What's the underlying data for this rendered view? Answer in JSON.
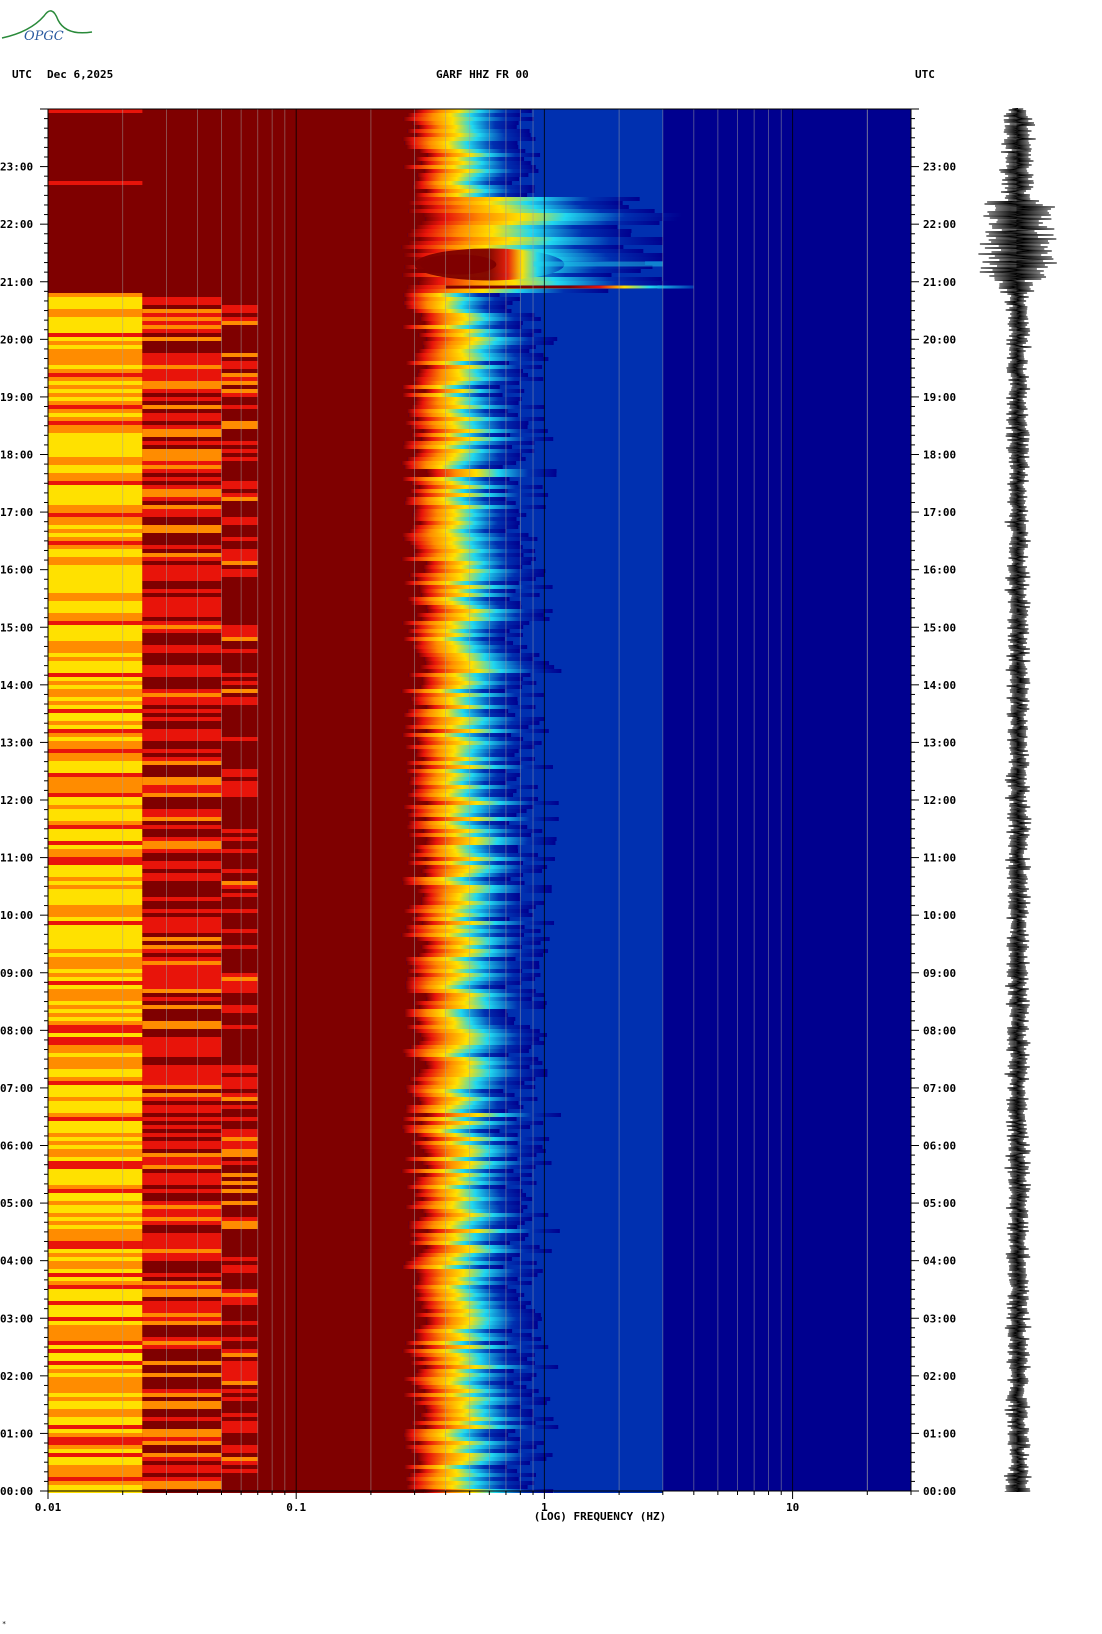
{
  "header": {
    "left_tz": "UTC",
    "date": "Dec 6,2025",
    "station": "GARF HHZ FR 00",
    "right_tz": "UTC"
  },
  "logo": {
    "text": "OPGC"
  },
  "colors": {
    "dark_red": "#7f0000",
    "red": "#e8140a",
    "orange": "#ff8c00",
    "yellow": "#ffe100",
    "cyan": "#20d8f0",
    "blue": "#0030b0",
    "navy": "#00008f"
  },
  "chart_data": {
    "type": "heatmap",
    "title": "GARF HHZ FR 00",
    "xlabel": "(LOG) FREQUENCY (HZ)",
    "xscale": "log",
    "xlim": [
      0.01,
      30
    ],
    "x_ticks": [
      {
        "value": 0.01,
        "label": "0.01"
      },
      {
        "value": 0.1,
        "label": "0.1"
      },
      {
        "value": 1,
        "label": "1"
      },
      {
        "value": 10,
        "label": "10"
      }
    ],
    "ylim_hours": [
      0,
      24
    ],
    "y_ticks": [
      "00:00",
      "01:00",
      "02:00",
      "03:00",
      "04:00",
      "05:00",
      "06:00",
      "07:00",
      "08:00",
      "09:00",
      "10:00",
      "11:00",
      "12:00",
      "13:00",
      "14:00",
      "15:00",
      "16:00",
      "17:00",
      "18:00",
      "19:00",
      "20:00",
      "21:00",
      "22:00",
      "23:00"
    ],
    "event": {
      "start_hour": 20.85,
      "end_hour": 22.5,
      "peak_hour": 21.3
    },
    "noise_edge_hz": 0.3,
    "grid": true
  }
}
